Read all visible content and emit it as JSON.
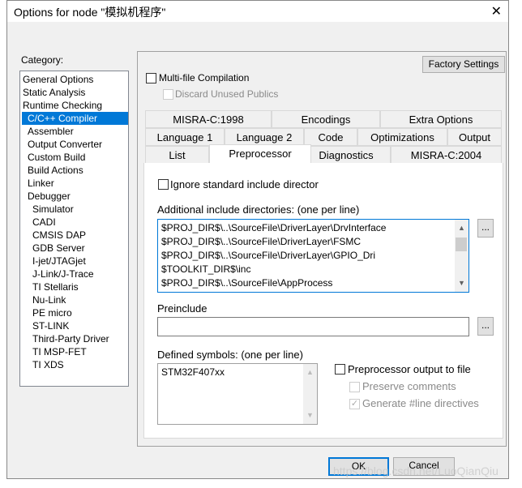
{
  "window": {
    "title": "Options for node \"模拟机程序\"",
    "close": "✕"
  },
  "category": {
    "label": "Category:",
    "items": [
      {
        "label": "General Options",
        "sub": false
      },
      {
        "label": "Static Analysis",
        "sub": false
      },
      {
        "label": "Runtime Checking",
        "sub": false
      },
      {
        "label": "C/C++ Compiler",
        "sub": true,
        "selected": true
      },
      {
        "label": "Assembler",
        "sub": true
      },
      {
        "label": "Output Converter",
        "sub": true
      },
      {
        "label": "Custom Build",
        "sub": true
      },
      {
        "label": "Build Actions",
        "sub": true
      },
      {
        "label": "Linker",
        "sub": true
      },
      {
        "label": "Debugger",
        "sub": true
      },
      {
        "label": "Simulator",
        "sub": true,
        "deep": true
      },
      {
        "label": "CADI",
        "sub": true,
        "deep": true
      },
      {
        "label": "CMSIS DAP",
        "sub": true,
        "deep": true
      },
      {
        "label": "GDB Server",
        "sub": true,
        "deep": true
      },
      {
        "label": "I-jet/JTAGjet",
        "sub": true,
        "deep": true
      },
      {
        "label": "J-Link/J-Trace",
        "sub": true,
        "deep": true
      },
      {
        "label": "TI Stellaris",
        "sub": true,
        "deep": true
      },
      {
        "label": "Nu-Link",
        "sub": true,
        "deep": true
      },
      {
        "label": "PE micro",
        "sub": true,
        "deep": true
      },
      {
        "label": "ST-LINK",
        "sub": true,
        "deep": true
      },
      {
        "label": "Third-Party Driver",
        "sub": true,
        "deep": true
      },
      {
        "label": "TI MSP-FET",
        "sub": true,
        "deep": true
      },
      {
        "label": "TI XDS",
        "sub": true,
        "deep": true
      }
    ]
  },
  "factory_settings": "Factory Settings",
  "multi_file": {
    "label": "Multi-file Compilation",
    "checked": false
  },
  "discard_unused": {
    "label": "Discard Unused Publics",
    "checked": false,
    "disabled": true
  },
  "tabs": {
    "row1": [
      "MISRA-C:1998",
      "Encodings",
      "Extra Options"
    ],
    "row2": [
      "Language 1",
      "Language 2",
      "Code",
      "Optimizations",
      "Output"
    ],
    "row3": [
      "List",
      "Preprocessor",
      "Diagnostics",
      "MISRA-C:2004"
    ],
    "selected": "Preprocessor"
  },
  "preprocessor": {
    "ignore_std": {
      "label": "Ignore standard include directories",
      "checked": false
    },
    "include_label": "Additional include directories: (one per line)",
    "include_dirs": [
      "$PROJ_DIR$\\..\\SourceFile\\DriverLayer\\DrvInterface",
      "$PROJ_DIR$\\..\\SourceFile\\DriverLayer\\FSMC",
      "$PROJ_DIR$\\..\\SourceFile\\DriverLayer\\GPIO_Dri",
      "$TOOLKIT_DIR$\\inc",
      "$PROJ_DIR$\\..\\SourceFile\\AppProcess"
    ],
    "browse": "...",
    "preinclude_label": "Preinclude",
    "preinclude_value": "",
    "defined_label": "Defined symbols: (one per line)",
    "defined": [
      "STM32F407xx"
    ],
    "pp_output": {
      "label": "Preprocessor output to file",
      "checked": false
    },
    "preserve": {
      "label": "Preserve comments",
      "checked": false,
      "disabled": true
    },
    "genline": {
      "label": "Generate #line directives",
      "checked": true,
      "disabled": true
    }
  },
  "ok": "OK",
  "cancel": "Cancel",
  "watermark": "https://blog.csdn.net/LuoQianQiu",
  "colors": {
    "selection": "#0078d7",
    "dialog_bg": "#f0f0f0"
  }
}
